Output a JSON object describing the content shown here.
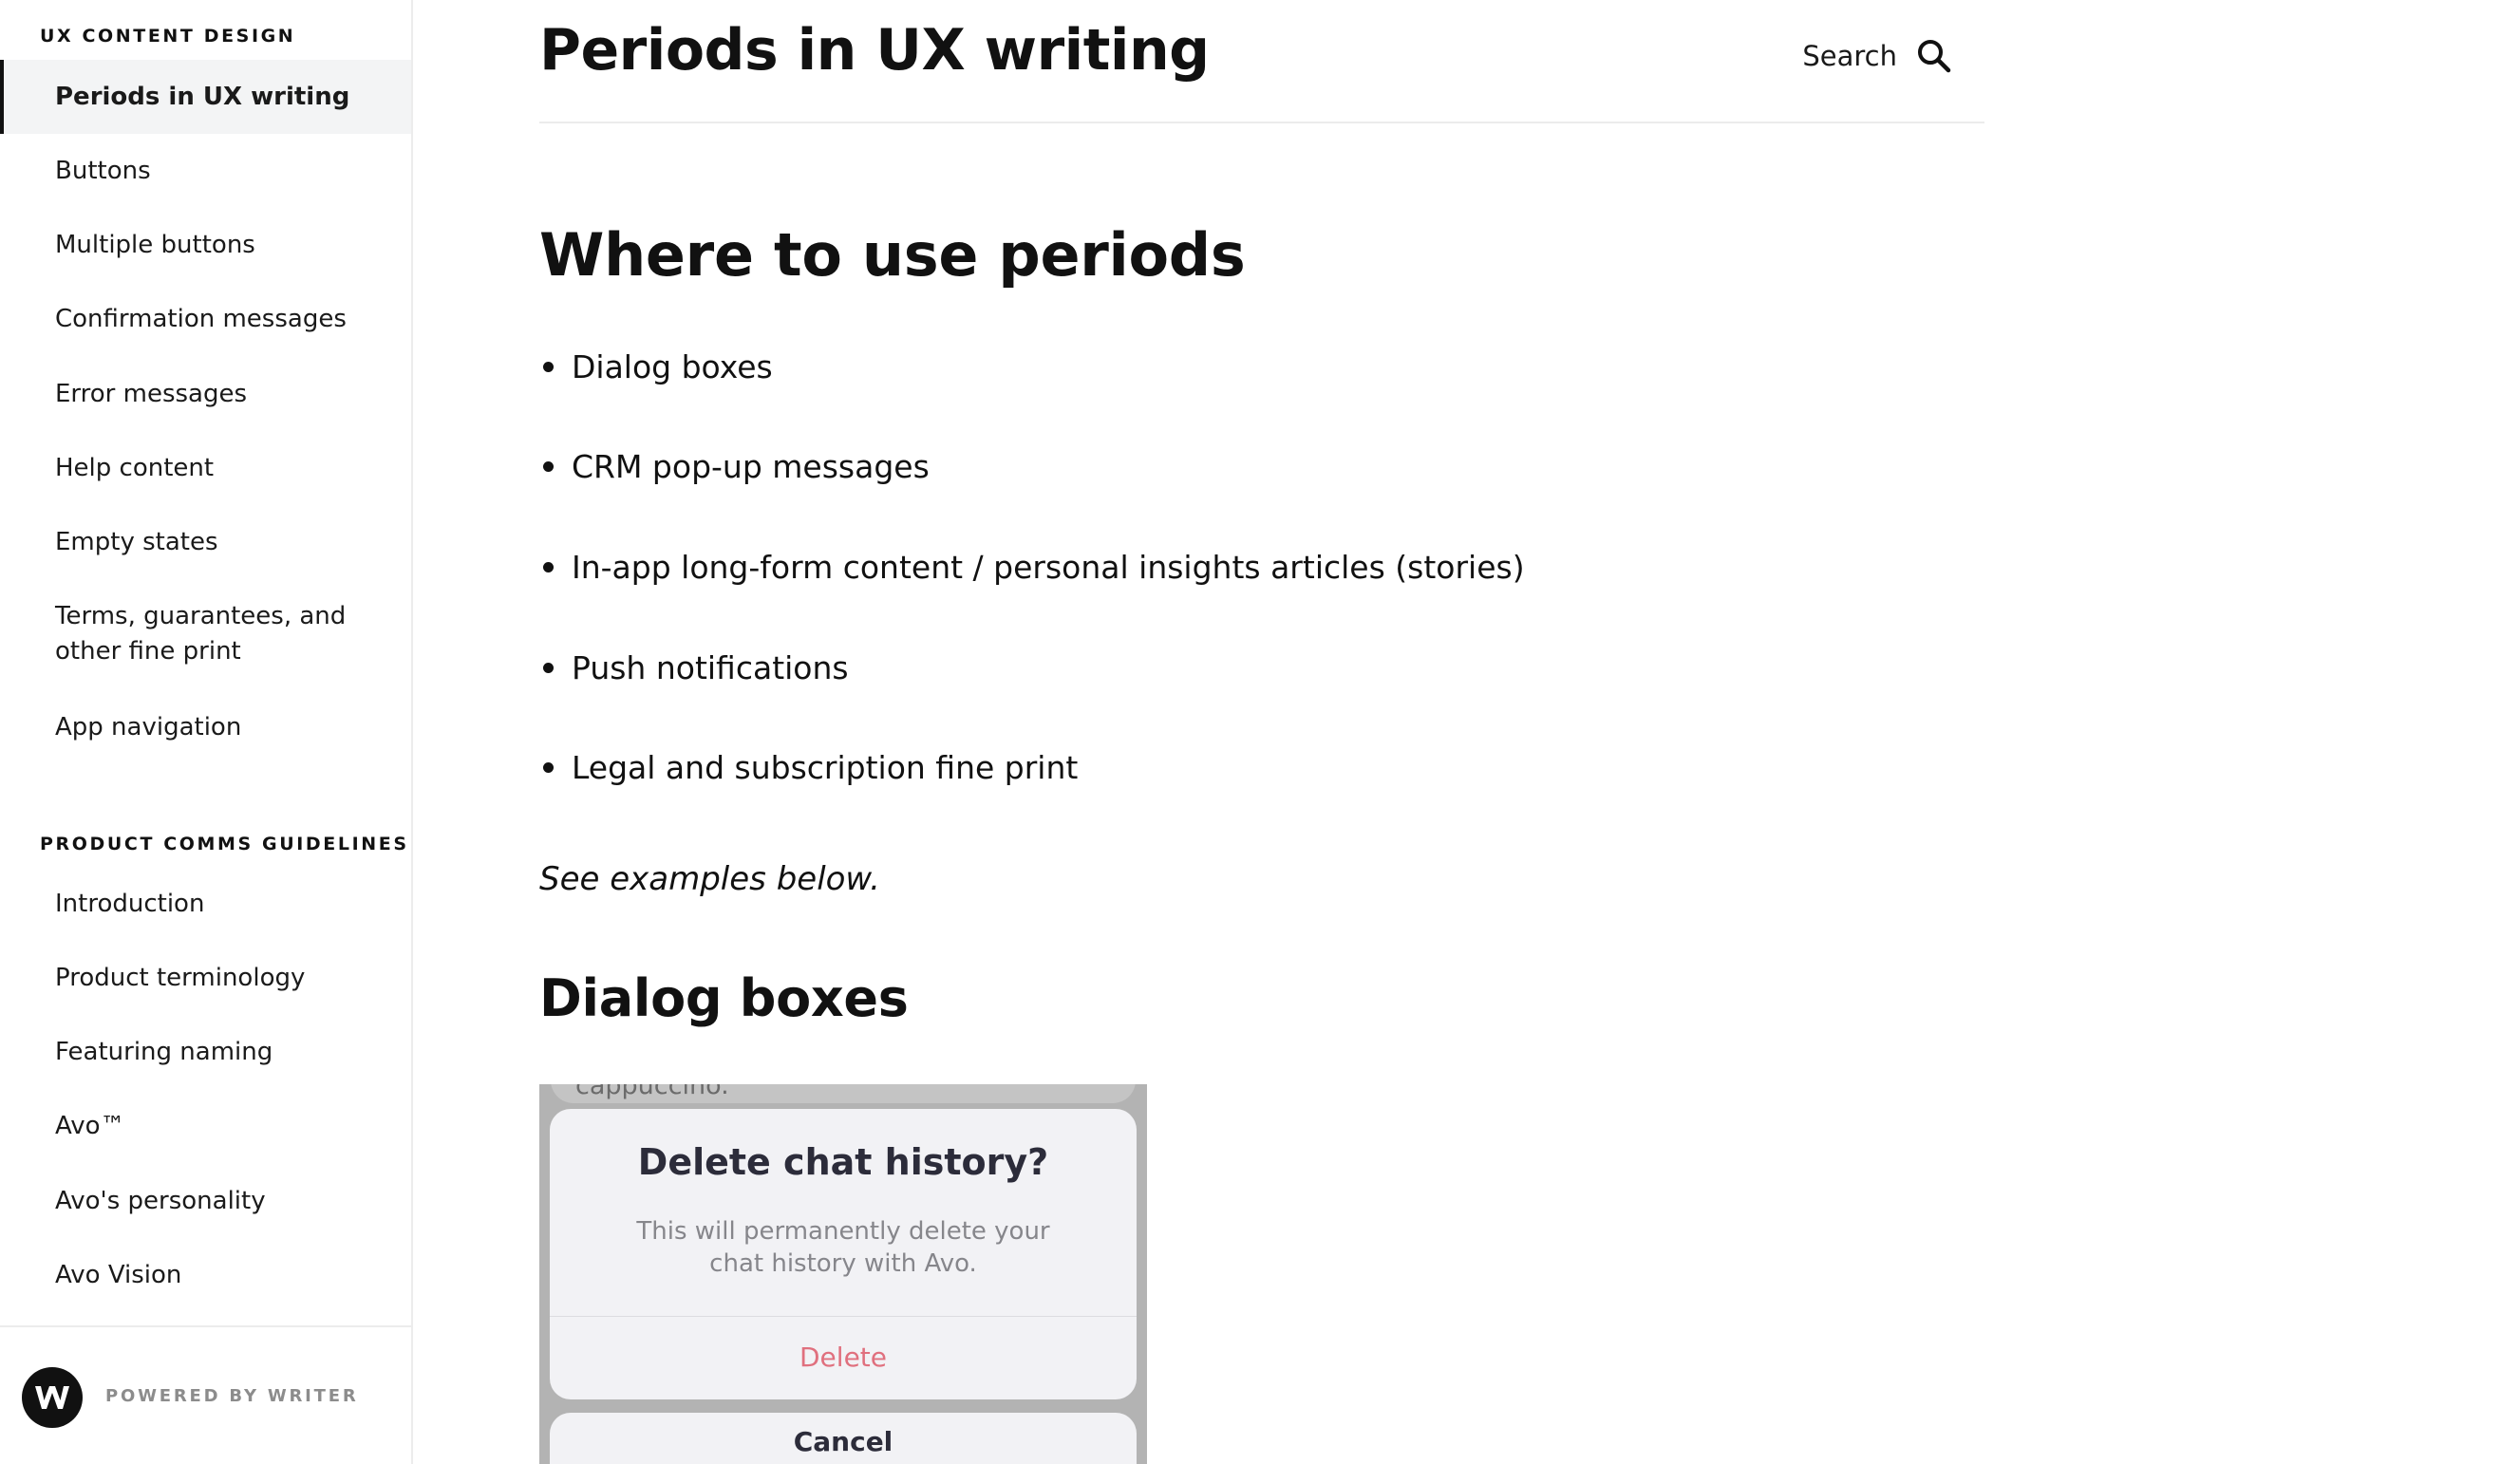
{
  "sidebar": {
    "sections": [
      {
        "heading": "UX CONTENT DESIGN",
        "items": [
          {
            "label": "Periods in UX writing",
            "active": true
          },
          {
            "label": "Buttons"
          },
          {
            "label": "Multiple buttons"
          },
          {
            "label": "Confirmation messages"
          },
          {
            "label": "Error messages"
          },
          {
            "label": "Help content"
          },
          {
            "label": "Empty states"
          },
          {
            "label": "Terms, guarantees, and other fine print"
          },
          {
            "label": "App navigation"
          }
        ]
      },
      {
        "heading": "PRODUCT COMMS GUIDELINES",
        "items": [
          {
            "label": "Introduction"
          },
          {
            "label": "Product terminology"
          },
          {
            "label": "Featuring naming"
          },
          {
            "label": "Avo™"
          },
          {
            "label": "Avo's personality"
          },
          {
            "label": "Avo Vision"
          }
        ]
      }
    ],
    "footer": {
      "logo_letter": "W",
      "powered_by": "POWERED BY WRITER"
    }
  },
  "header": {
    "title": "Periods in UX writing",
    "search_label": "Search",
    "search_icon": "search-icon"
  },
  "content": {
    "section_title": "Where to use periods",
    "bullets": [
      "Dialog boxes",
      "CRM pop-up messages",
      "In-app long-form content / personal insights articles (stories)",
      "Push notifications",
      "Legal and subscription fine print"
    ],
    "note": "See examples below.",
    "subsection_title": "Dialog boxes",
    "example": {
      "behind_text": "cappuccino.",
      "dialog_title": "Delete chat history?",
      "dialog_message": "This will permanently delete your chat history with Avo.",
      "delete_label": "Delete",
      "cancel_label": "Cancel"
    }
  },
  "colors": {
    "active_bg": "#f3f4f5",
    "delete_red": "#e0707e",
    "muted_text": "#8c8c8c"
  }
}
